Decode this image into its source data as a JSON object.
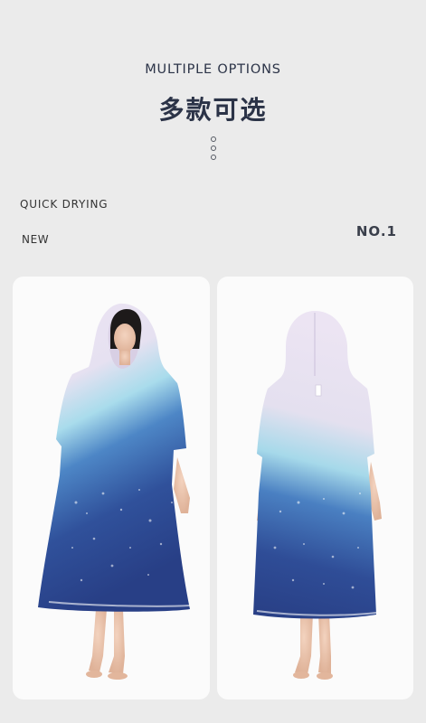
{
  "header": {
    "title_en": "MULTIPLE OPTIONS",
    "title_cn": "多款可选"
  },
  "tags": {
    "quick_drying": "QUICK DRYING",
    "new": "NEW",
    "number": "NO.1"
  },
  "colors": {
    "background": "#ebebeb",
    "card": "#fbfbfb",
    "text_dark": "#2b3347",
    "poncho_lilac": "#e8dff0",
    "poncho_light_blue": "#9dd6ea",
    "poncho_deep_blue": "#2f4b94"
  },
  "images": {
    "front_view": "woman-wearing-hooded-poncho-front-icon",
    "back_view": "woman-wearing-hooded-poncho-back-icon"
  }
}
